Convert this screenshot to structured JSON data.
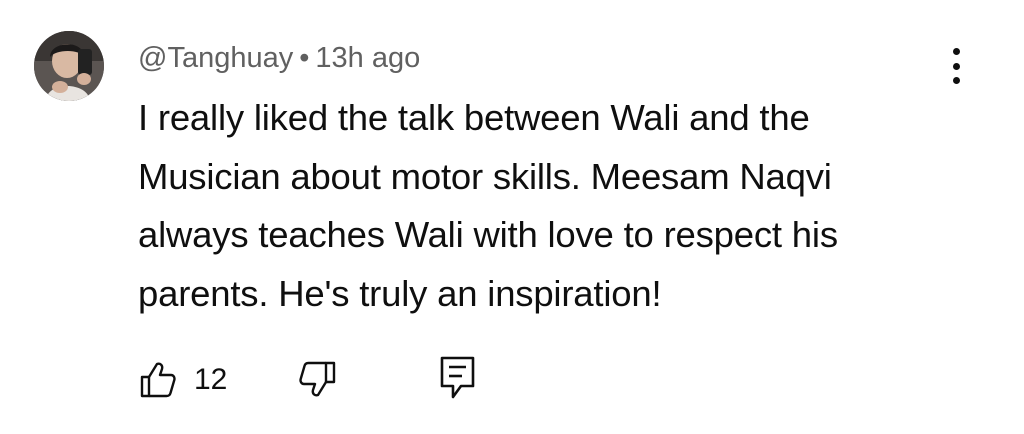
{
  "comment": {
    "author": "@Tanghuay",
    "separator": "•",
    "time": "13h ago",
    "text_lines": [
      "I really liked the talk between Wali and the",
      "Musician about motor skills. Meesam Naqvi",
      "always teaches Wali with love to respect his",
      "parents. He's truly an inspiration!"
    ],
    "like_count": "12"
  },
  "icons": {
    "avatar": "avatar",
    "more": "more-vert-icon",
    "like": "thumbs-up-icon",
    "dislike": "thumbs-down-icon",
    "reply": "reply-comment-icon"
  },
  "colors": {
    "text": "#0f0f0f",
    "meta": "#606060",
    "background": "#ffffff"
  }
}
